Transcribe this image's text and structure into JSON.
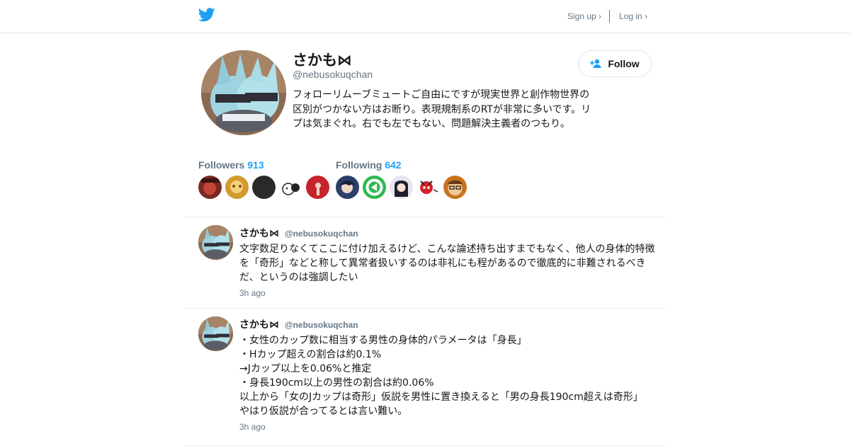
{
  "header": {
    "logo_icon": "twitter-bird-icon",
    "signup_label": "Sign up ›",
    "login_label": "Log in ›",
    "brand_color": "#1da1f2"
  },
  "profile": {
    "display_name": "さかも⋈",
    "screen_name": "@nebusokuqchan",
    "bio": "フォローリムーブミュートご自由にですが現実世界と創作物世界の区別がつかない方はお断り。表現規制系のRTが非常に多いです。リプは気まぐれ。右でも左でもない、問題解決主義者のつもり。",
    "follow_label": "Follow",
    "followers_label": "Followers",
    "followers_count": "913",
    "following_label": "Following",
    "following_count": "642"
  },
  "tweets": [
    {
      "name": "さかも⋈",
      "handle": "@nebusokuqchan",
      "text": "文字数足りなくてここに付け加えるけど、こんな論述持ち出すまでもなく、他人の身体的特徴を「奇形」などと称して異常者扱いするのは非礼にも程があるので徹底的に非難されるべきだ、というのは強調したい",
      "time": "3h ago"
    },
    {
      "name": "さかも⋈",
      "handle": "@nebusokuqchan",
      "text": "・女性のカップ数に相当する男性の身体的パラメータは「身長」\n・Hカップ超えの割合は約0.1%\n→Jカップ以上を0.06%と推定\n・身長190cm以上の男性の割合は約0.06%\n以上から「女のJカップは奇形」仮説を男性に置き換えると「男の身長190cm超えは奇形」\nやはり仮説が合ってるとは言い難い。",
      "time": "3h ago"
    }
  ]
}
